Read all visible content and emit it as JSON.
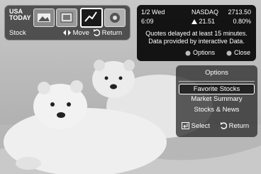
{
  "appbar": {
    "logo_line1": "USA",
    "logo_line2": "TODAY",
    "app_label": "Stock",
    "move_label": "Move",
    "return_label": "Return",
    "icons": [
      "usa-today-logo",
      "photo-app-icon",
      "screen-app-icon",
      "stock-app-icon",
      "game-app-icon"
    ]
  },
  "ticker": {
    "date": "1/2 Wed",
    "time": "6:09",
    "index": "NASDAQ",
    "value": "2713.50",
    "change": "21.51",
    "change_direction": "up",
    "percent": "0.80%",
    "note_line1": "Quotes delayed at least 15 minutes.",
    "note_line2": "Data provided by interactive Data.",
    "options_label": "Options",
    "close_label": "Close"
  },
  "options_panel": {
    "title": "Options",
    "items": [
      "Favorite Stocks",
      "Market Summary",
      "Stocks & News"
    ],
    "selected_index": 0,
    "select_label": "Select",
    "return_label": "Return"
  }
}
